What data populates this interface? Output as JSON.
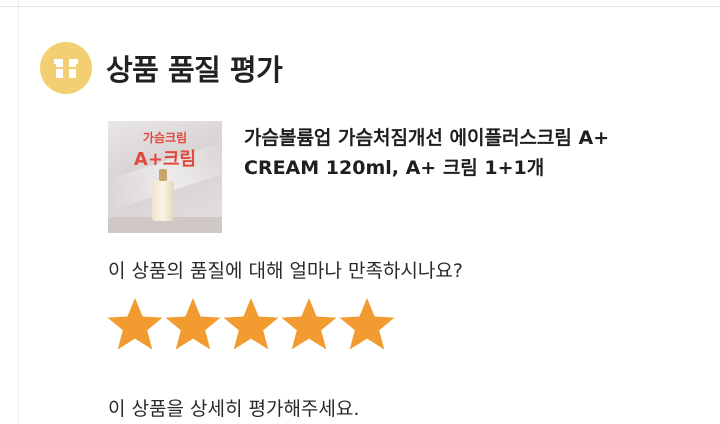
{
  "header": {
    "title": "상품 품질 평가",
    "icon": "box-icon"
  },
  "product": {
    "name": "가슴볼륨업 가슴처짐개선 에이플러스크림 A+ CREAM 120ml, A+ 크림 1+1개",
    "thumbnail_text_line1": "가슴크림",
    "thumbnail_text_line2": "A+크림"
  },
  "rating": {
    "question": "이 상품의 품질에 대해 얼마나 만족하시나요?",
    "max": 5,
    "value": 5,
    "star_color": "#f29b30"
  },
  "detail_prompt": "이 상품을 상세히 평가해주세요.",
  "colors": {
    "badge": "#f3ce72",
    "star": "#f29b30"
  }
}
